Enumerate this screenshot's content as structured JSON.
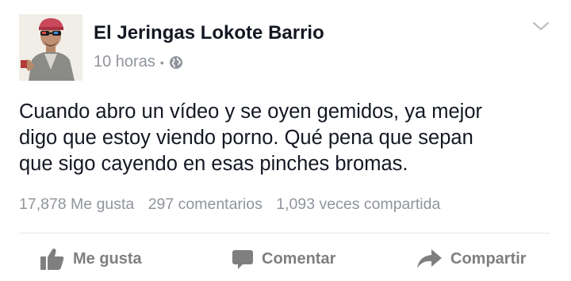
{
  "post": {
    "author": "El Jeringas Lokote Barrio",
    "timestamp": "10 horas",
    "separator": "•",
    "audience_icon": "globe-icon",
    "menu_icon": "chevron-down-icon",
    "text_lines": [
      "Cuando abro un vídeo y se oyen gemidos, ya mejor",
      "digo que estoy viendo porno. Qué pena que sepan",
      "que sigo cayendo en esas pinches bromas."
    ]
  },
  "stats": {
    "likes": "17,878 Me gusta",
    "comments": "297 comentarios",
    "shares": "1,093 veces compartida"
  },
  "actions": {
    "like_label": "Me gusta",
    "comment_label": "Comentar",
    "share_label": "Compartir"
  },
  "colors": {
    "text": "#141823",
    "muted": "#90949c",
    "action": "#7f7f7f",
    "divider": "#e5e5e5"
  }
}
